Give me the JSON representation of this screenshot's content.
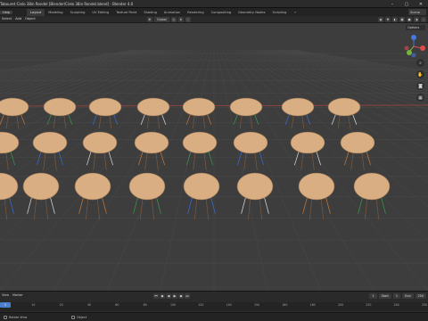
{
  "window": {
    "title": "Tabouret Cielo 38in Rondel [Blender\\Cielo 38in Rondel.blend] - Blender 4.0",
    "controls": [
      "–",
      "▢",
      "✕"
    ]
  },
  "topbar": {
    "menu": [
      "Help"
    ],
    "tabs": [
      {
        "label": "Layout",
        "active": true
      },
      {
        "label": "Modeling",
        "active": false
      },
      {
        "label": "Sculpting",
        "active": false
      },
      {
        "label": "UV Editing",
        "active": false
      },
      {
        "label": "Texture Paint",
        "active": false
      },
      {
        "label": "Shading",
        "active": false
      },
      {
        "label": "Animation",
        "active": false
      },
      {
        "label": "Rendering",
        "active": false
      },
      {
        "label": "Compositing",
        "active": false
      },
      {
        "label": "Geometry Nodes",
        "active": false
      },
      {
        "label": "Scripting",
        "active": false
      }
    ],
    "add_tab": "+",
    "scene_field": "Scene"
  },
  "header": {
    "menu": [
      "Select",
      "Add",
      "Object"
    ],
    "transform_orientation": "Global",
    "options_label": "Options"
  },
  "viewport": {
    "grid_color": "#4a4a4a",
    "axis_x_color": "#a0453f",
    "axis_y_color": "#8a9a3a",
    "seat_color": "#d9ae83",
    "seat_edge": "#8e6e50",
    "gizmo": {
      "x": "#e24b4b",
      "y": "#74b53d",
      "z": "#4477e0"
    },
    "nav_icons": [
      "zoom-icon",
      "hand-icon",
      "camera-icon",
      "grid-icon"
    ]
  },
  "timeline": {
    "menu": [
      "View",
      "Marker"
    ],
    "current_frame": "1",
    "start_label": "Start",
    "start_value": "1",
    "end_label": "End",
    "end_value": "250",
    "ruler": [
      "0",
      "10",
      "20",
      "40",
      "60",
      "80",
      "100",
      "120",
      "140",
      "150",
      "160",
      "180",
      "200",
      "220",
      "240",
      "250"
    ]
  },
  "statusbar": {
    "left": "Rotate View",
    "middle": "Object"
  }
}
